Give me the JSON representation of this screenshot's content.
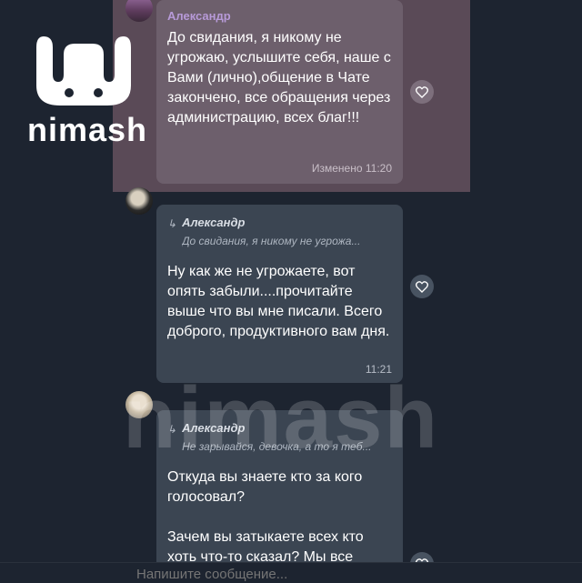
{
  "brand": {
    "logo_text": "nimash",
    "watermark_text": "nimash"
  },
  "messages": [
    {
      "sender": "Александр",
      "text": "До свидания, я никому не угрожаю, услышите себя, наше с Вами (лично),общение в Чате закончено, все обращения через администрацию, всех благ!!!",
      "meta": "Изменено 11:20"
    },
    {
      "reply": {
        "name": "Александр",
        "snippet": "До свидания, я никому не угрожа..."
      },
      "text": "Ну как же не угрожаете, вот опять забыли....прочитайте выше что вы мне писали. Всего доброго, продуктивного вам дня.",
      "meta": "11:21"
    },
    {
      "reply": {
        "name": "Александр",
        "snippet": "Не зарывайся, девочка, а то я теб..."
      },
      "text": "Откуда вы знаете кто за кого голосовал?\n\nЗачем вы затыкаете всех кто хоть что-то сказал? Мы все"
    }
  ],
  "composer": {
    "placeholder": "Напишите сообщение..."
  },
  "colors": {
    "background": "#1d2430",
    "highlight": "#5a4a57",
    "bubble": "#3b4552",
    "sender_name": "#b79ad8"
  }
}
